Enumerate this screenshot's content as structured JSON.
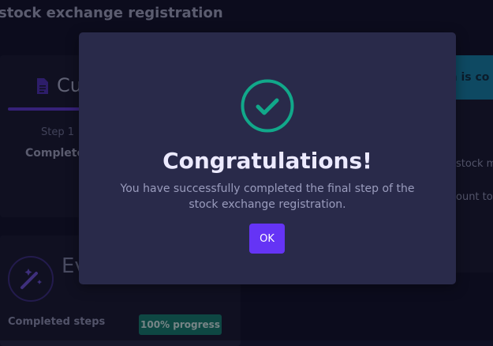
{
  "page": {
    "title": "stock exchange registration"
  },
  "left_card": {
    "tab_label": "Cu",
    "step_label": "Step 1",
    "step_value": "Complete"
  },
  "left_card2": {
    "title": "Ev",
    "completed_label": "Completed steps",
    "progress_badge": "100% progress",
    "progress": 1.0
  },
  "right_card": {
    "banner": "on is co",
    "line1": "stock ma",
    "line2": "ount to b"
  },
  "modal": {
    "title": "Congratulations!",
    "message": "You have successfully completed the final step of the stock exchange registration.",
    "ok_label": "OK",
    "icon": "check-circle-icon",
    "accent": "#11a88a",
    "button_color": "#6534f5"
  }
}
